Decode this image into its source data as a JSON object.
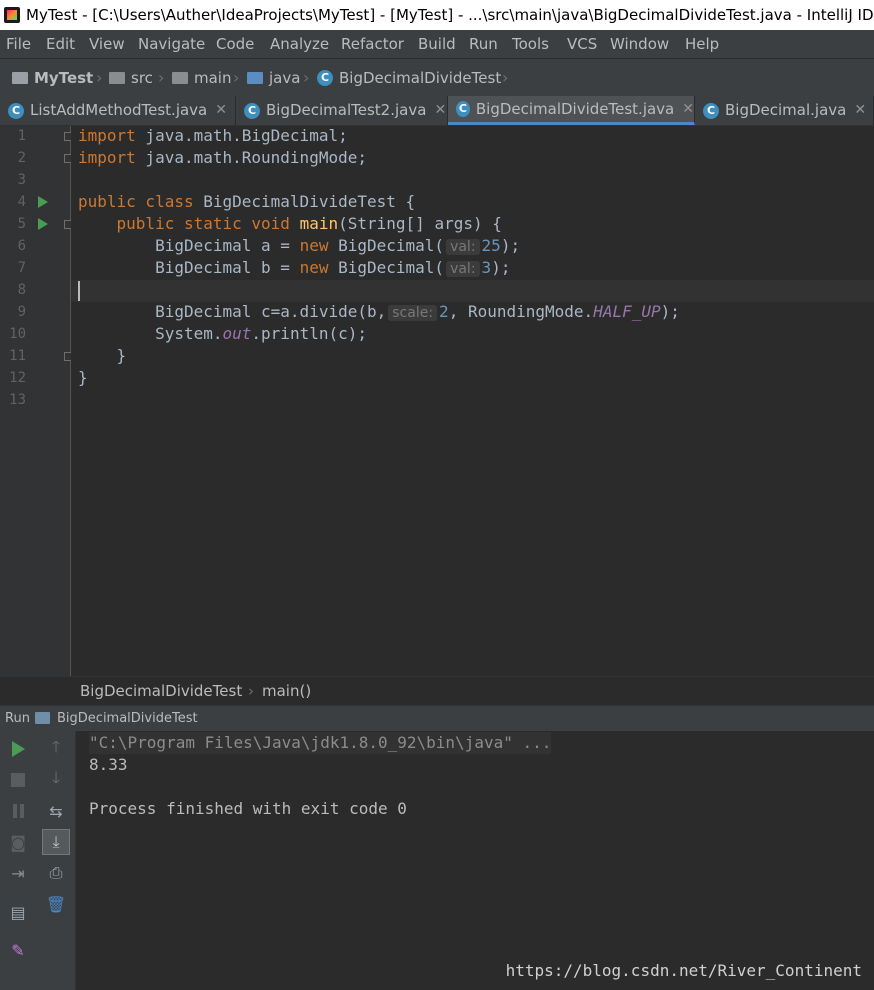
{
  "window": {
    "title": "MyTest - [C:\\Users\\Auther\\IdeaProjects\\MyTest] - [MyTest] - ...\\src\\main\\java\\BigDecimalDivideTest.java - IntelliJ IDEA"
  },
  "menu": [
    "File",
    "Edit",
    "View",
    "Navigate",
    "Code",
    "Analyze",
    "Refactor",
    "Build",
    "Run",
    "Tools",
    "VCS",
    "Window",
    "Help"
  ],
  "navbar": {
    "project": "MyTest",
    "src": "src",
    "main": "main",
    "java": "java",
    "file": "BigDecimalDivideTest"
  },
  "tabs": [
    {
      "label": "ListAddMethodTest.java"
    },
    {
      "label": "BigDecimalTest2.java"
    },
    {
      "label": "BigDecimalDivideTest.java"
    },
    {
      "label": "BigDecimal.java"
    }
  ],
  "editor": {
    "line_numbers": [
      "1",
      "2",
      "3",
      "4",
      "5",
      "6",
      "7",
      "8",
      "9",
      "10",
      "11",
      "12",
      "13"
    ],
    "code": {
      "l1": {
        "kw": "import",
        "rest": " java.math.BigDecimal;"
      },
      "l2": {
        "kw": "import",
        "rest": " java.math.RoundingMode;"
      },
      "l4": {
        "kw1": "public",
        "kw2": " class",
        "rest": " BigDecimalDivideTest {"
      },
      "l5": {
        "indent": "    ",
        "kw1": "public",
        "kw2": " static",
        "kw3": " void",
        "fn": " main",
        "rest": "(String[] args) {"
      },
      "l6": {
        "pre": "        BigDecimal a = ",
        "kw": "new",
        "mid": " BigDecimal(",
        "hint": "val:",
        "num": "25",
        "post": ");"
      },
      "l7": {
        "pre": "        BigDecimal b = ",
        "kw": "new",
        "mid": " BigDecimal(",
        "hint": "val:",
        "num": "3",
        "post": ");"
      },
      "l9": {
        "pre": "        BigDecimal c=a.divide(b,",
        "hint": "scale:",
        "num": "2",
        "mid": ", RoundingMode.",
        "fld": "HALF_UP",
        "post": ");"
      },
      "l10": {
        "pre": "        System.",
        "fld": "out",
        "post": ".println(c);"
      },
      "l11": {
        "text": "    }"
      },
      "l12": {
        "text": "}"
      }
    }
  },
  "breadcrumbs": {
    "class": "BigDecimalDivideTest",
    "method": "main()"
  },
  "run": {
    "label": "Run",
    "config": "BigDecimalDivideTest",
    "output": [
      "\"C:\\Program Files\\Java\\jdk1.8.0_92\\bin\\java\" ...",
      "8.33",
      "",
      "Process finished with exit code 0"
    ]
  },
  "watermark": "https://blog.csdn.net/River_Continent",
  "colors": {
    "keyword": "#cc7832",
    "function": "#ffc66d",
    "number": "#6897bb",
    "field": "#9876aa",
    "text": "#a9b7c6",
    "run_green": "#499c54",
    "active_tab_underline": "#4a88c7"
  }
}
